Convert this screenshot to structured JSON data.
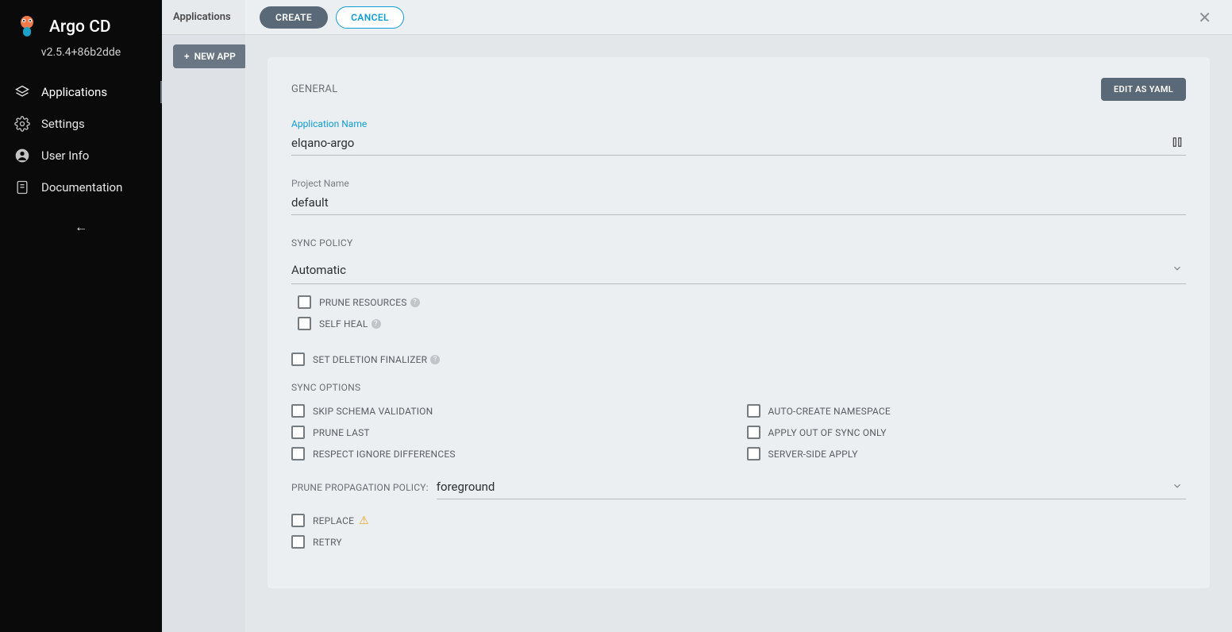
{
  "brand": "Argo CD",
  "version": "v2.5.4+86b2dde",
  "nav": {
    "applications": "Applications",
    "settings": "Settings",
    "user_info": "User Info",
    "documentation": "Documentation"
  },
  "page": {
    "title": "Applications",
    "new_app": "NEW APP"
  },
  "panel": {
    "create": "CREATE",
    "cancel": "CANCEL",
    "edit_yaml": "EDIT AS YAML",
    "general": "GENERAL",
    "app_name_label": "Application Name",
    "app_name_value": "elqano-argo",
    "project_name_label": "Project Name",
    "project_name_value": "default",
    "sync_policy_label": "SYNC POLICY",
    "sync_policy_value": "Automatic",
    "prune_resources": "PRUNE RESOURCES",
    "self_heal": "SELF HEAL",
    "set_deletion_finalizer": "SET DELETION FINALIZER",
    "sync_options": "SYNC OPTIONS",
    "skip_schema": "SKIP SCHEMA VALIDATION",
    "auto_create_ns": "AUTO-CREATE NAMESPACE",
    "prune_last": "PRUNE LAST",
    "apply_oos": "APPLY OUT OF SYNC ONLY",
    "respect_ignore": "RESPECT IGNORE DIFFERENCES",
    "server_side": "SERVER-SIDE APPLY",
    "prune_prop_label": "PRUNE PROPAGATION POLICY:",
    "prune_prop_value": "foreground",
    "replace": "REPLACE",
    "retry": "RETRY"
  }
}
